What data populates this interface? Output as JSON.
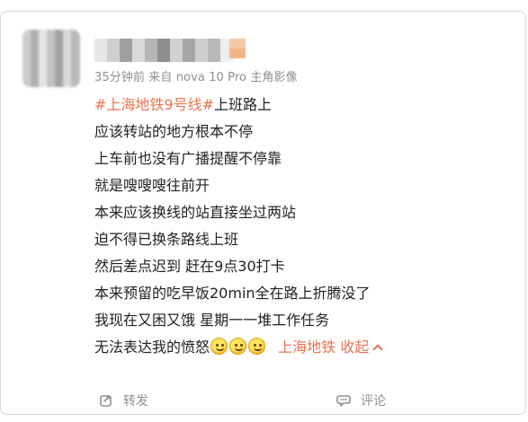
{
  "post": {
    "meta": "35分钟前  来自 nova 10 Pro 主角影像",
    "hashtag": "#上海地铁9号线#",
    "line1_suffix": "上班路上",
    "lines": [
      "应该转站的地方根本不停",
      "上车前也没有广播提醒不停靠",
      "就是嗖嗖嗖往前开",
      "本来应该换线的站直接坐过两站",
      "迫不得已换条路线上班",
      "然后差点迟到 赶在9点30打卡",
      "本来预留的吃早饭20min全在路上折腾没了",
      "我现在又困又饿 星期一一堆工作任务"
    ],
    "last_line_prefix": "无法表达我的愤怒",
    "location_label": "上海地铁",
    "collapse_label": "收起"
  },
  "footer": {
    "repost_label": "转发",
    "comment_label": "评论"
  },
  "colors": {
    "accent": "#eb7350",
    "text": "#222222",
    "muted": "#8f8f8f",
    "border": "#d9d9d9"
  },
  "icons": {
    "emoji": "smile-emoji-icon",
    "location": "location-pin-icon",
    "collapse": "chevron-up-icon",
    "repost": "repost-icon",
    "comment": "comment-icon"
  }
}
